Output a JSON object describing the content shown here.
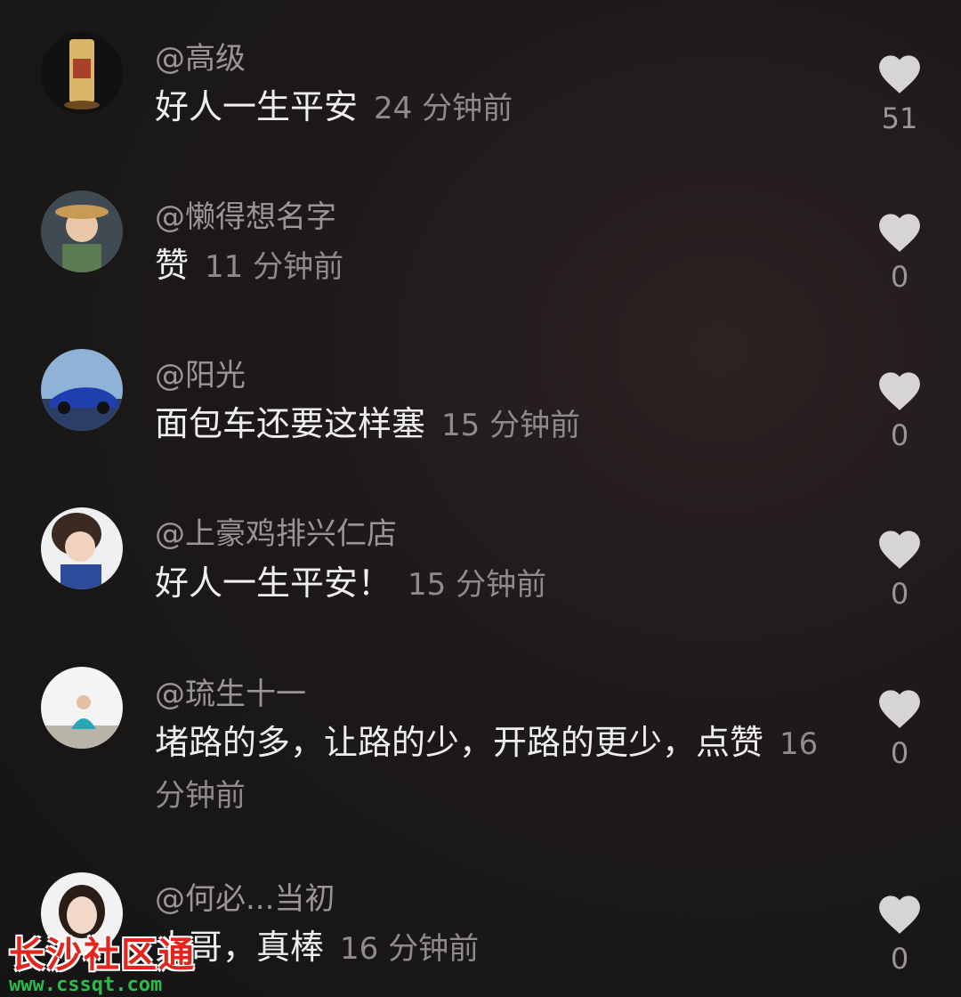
{
  "comments": [
    {
      "user": "@高级",
      "text": "好人一生平安",
      "time": "24 分钟前",
      "likes": "51",
      "avatar": "carving-avatar"
    },
    {
      "user": "@懒得想名字",
      "text": "赞",
      "time": "11 分钟前",
      "likes": "0",
      "avatar": "anime-girl-avatar"
    },
    {
      "user": "@阳光",
      "text": "面包车还要这样塞",
      "time": "15 分钟前",
      "likes": "0",
      "avatar": "car-avatar"
    },
    {
      "user": "@上豪鸡排兴仁店",
      "text": "好人一生平安！",
      "time": "15 分钟前",
      "likes": "0",
      "avatar": "woman-avatar"
    },
    {
      "user": "@琉生十一",
      "text": "堵路的多，让路的少，开路的更少，点赞",
      "time": "16 分钟前",
      "likes": "0",
      "avatar": "sitting-person-avatar"
    },
    {
      "user": "@何必...当初",
      "text": "大哥，真棒",
      "time": "16 分钟前",
      "likes": "0",
      "avatar": "girl-portrait-avatar"
    }
  ],
  "watermark": {
    "title": "长沙社区通",
    "url": "www.cssqt.com"
  },
  "colors": {
    "like_icon": "#d6d4d4",
    "username": "#9a9696",
    "text": "#f0efef",
    "watermark_red": "#e2261d",
    "watermark_green": "#2fb94a"
  }
}
